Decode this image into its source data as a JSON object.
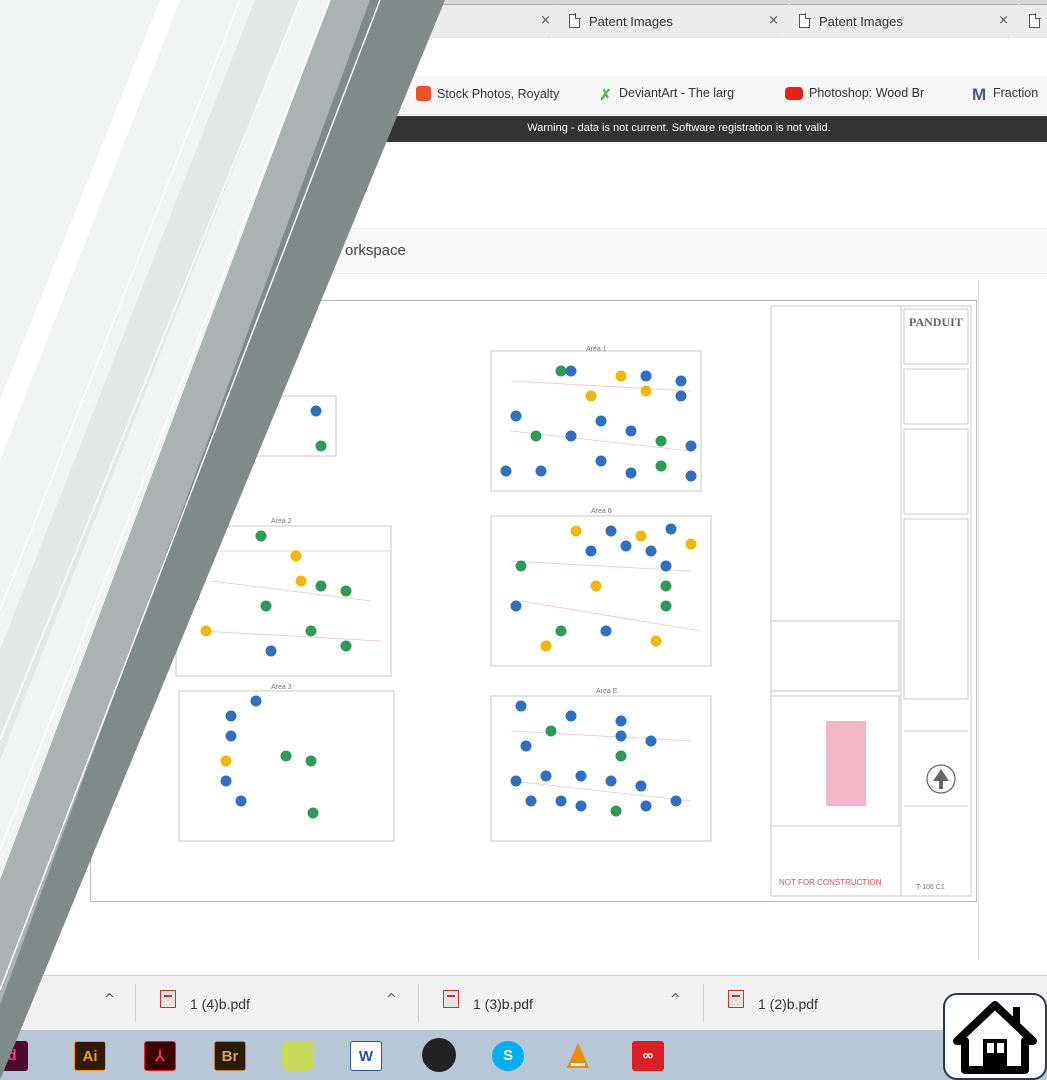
{
  "browser": {
    "tabs": [
      {
        "label": "",
        "close": "×"
      },
      {
        "label": "Patent Images",
        "close": "×"
      },
      {
        "label": "Patent Images",
        "close": "×"
      },
      {
        "label": "",
        "close": ""
      }
    ],
    "bookmarks": [
      {
        "label": "Stock Photos, Royalty",
        "icon": "stock-photos-icon",
        "color": "#e8532a"
      },
      {
        "label": "DeviantArt - The larg",
        "icon": "deviantart-icon",
        "color": "#4dc047"
      },
      {
        "label": "Photoshop: Wood Br",
        "icon": "youtube-icon",
        "color": "#e62117"
      },
      {
        "label": "Fraction",
        "icon": "m-icon",
        "color": "#3d5a99"
      }
    ],
    "warning": "Warning - data is not current. Software registration is not valid."
  },
  "page": {
    "workspace_title": "orkspace"
  },
  "drawing": {
    "brand": "PANDUIT",
    "areas": [
      "Area 1",
      "Area 2",
      "Area 3",
      "Area 6",
      "Area E"
    ],
    "stamp": "NOT FOR CONSTRUCTION",
    "sheet": "T-106 C1"
  },
  "downloads": [
    {
      "name": "1 (4)b.pdf",
      "caret": "^"
    },
    {
      "name": "1 (3)b.pdf",
      "caret": "^"
    },
    {
      "name": "1 (2)b.pdf",
      "caret": "^"
    }
  ],
  "taskbar": [
    {
      "label": "d",
      "icon": "indesign-icon"
    },
    {
      "label": "Ai",
      "icon": "illustrator-icon"
    },
    {
      "label": "",
      "icon": "acrobat-icon"
    },
    {
      "label": "Br",
      "icon": "bridge-icon"
    },
    {
      "label": "",
      "icon": "sketchbook-icon"
    },
    {
      "label": "W",
      "icon": "word-icon"
    },
    {
      "label": "",
      "icon": "media-icon"
    },
    {
      "label": "S",
      "icon": "skype-icon"
    },
    {
      "label": "",
      "icon": "vlc-icon"
    },
    {
      "label": "",
      "icon": "creative-cloud-icon"
    }
  ],
  "home": {
    "icon": "home-icon"
  },
  "colors": {
    "slant_dark": "#7f8b89",
    "slant_mid": "#aab3b1",
    "slant_light": "#e4e8e7",
    "marker_blue": "#2f6fc2",
    "marker_green": "#2e9a55",
    "marker_yellow": "#f2b705"
  }
}
